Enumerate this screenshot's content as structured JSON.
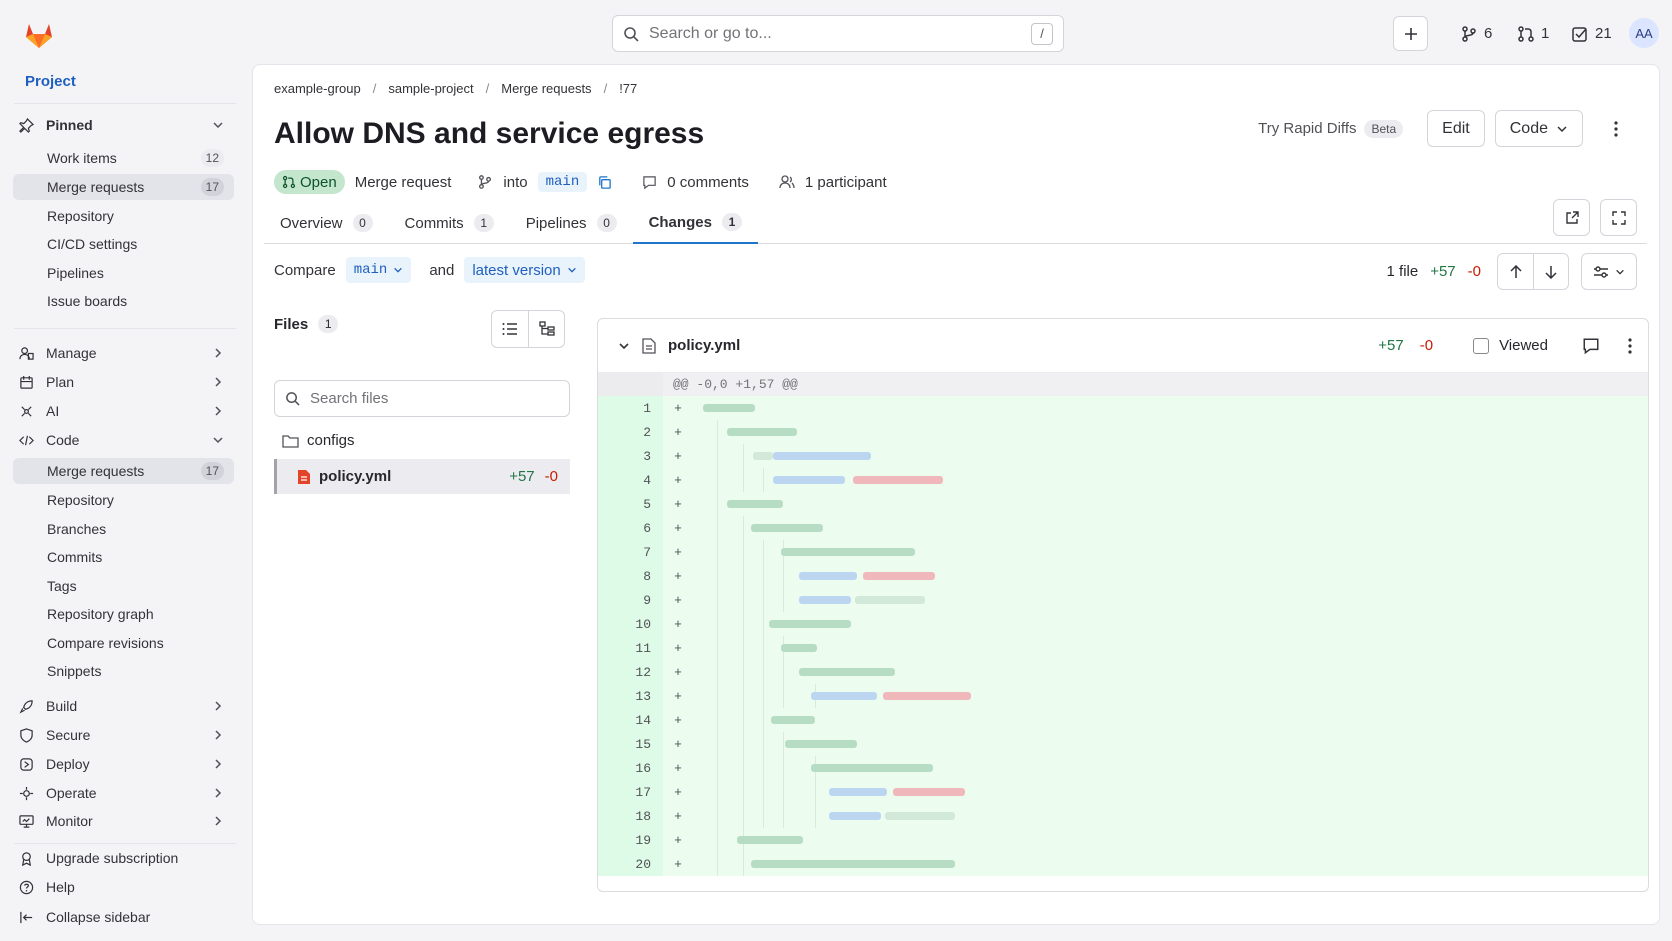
{
  "topbar": {
    "search_placeholder": "Search or go to...",
    "search_shortcut": "/",
    "assigned_mrs": "6",
    "review_mrs": "1",
    "todos": "21",
    "avatar_initials": "AA"
  },
  "sidebar": {
    "project_label": "Project",
    "pinned_label": "Pinned",
    "pinned": [
      {
        "label": "Work items",
        "count": "12"
      },
      {
        "label": "Merge requests",
        "count": "17"
      },
      {
        "label": "Repository"
      },
      {
        "label": "CI/CD settings"
      },
      {
        "label": "Pipelines"
      },
      {
        "label": "Issue boards"
      }
    ],
    "sections": {
      "manage": "Manage",
      "plan": "Plan",
      "ai": "AI",
      "code": "Code",
      "build": "Build",
      "secure": "Secure",
      "deploy": "Deploy",
      "operate": "Operate",
      "monitor": "Monitor"
    },
    "code_items": [
      {
        "label": "Merge requests",
        "count": "17"
      },
      {
        "label": "Repository"
      },
      {
        "label": "Branches"
      },
      {
        "label": "Commits"
      },
      {
        "label": "Tags"
      },
      {
        "label": "Repository graph"
      },
      {
        "label": "Compare revisions"
      },
      {
        "label": "Snippets"
      }
    ],
    "footer": {
      "upgrade": "Upgrade subscription",
      "help": "Help",
      "collapse": "Collapse sidebar"
    }
  },
  "breadcrumb": [
    "example-group",
    "sample-project",
    "Merge requests",
    "!77"
  ],
  "mr": {
    "title": "Allow DNS and service egress",
    "status": "Open",
    "type_label": "Merge request",
    "into_label": "into",
    "target_branch": "main",
    "comments": "0 comments",
    "participants": "1 participant"
  },
  "header_actions": {
    "rapid_diffs": "Try Rapid Diffs",
    "beta": "Beta",
    "edit": "Edit",
    "code": "Code"
  },
  "tabs": [
    {
      "label": "Overview",
      "count": "0"
    },
    {
      "label": "Commits",
      "count": "1"
    },
    {
      "label": "Pipelines",
      "count": "0"
    },
    {
      "label": "Changes",
      "count": "1"
    }
  ],
  "compare": {
    "label": "Compare",
    "base": "main",
    "and_label": "and",
    "head": "latest version"
  },
  "diffstats": {
    "files": "1 file",
    "added": "+57",
    "removed": "-0"
  },
  "file_browser": {
    "title": "Files",
    "count": "1",
    "search_placeholder": "Search files",
    "folder": "configs",
    "file": "policy.yml",
    "added": "+57",
    "removed": "-0"
  },
  "diff": {
    "filename": "policy.yml",
    "added": "+57",
    "removed": "-0",
    "viewed_label": "Viewed",
    "hunk": "@@ -0,0 +1,57 @@",
    "line_numbers": [
      "1",
      "2",
      "3",
      "4",
      "5",
      "6",
      "7",
      "8",
      "9",
      "10",
      "11",
      "12",
      "13",
      "14",
      "15",
      "16",
      "17",
      "18",
      "19",
      "20"
    ],
    "marker": "+"
  },
  "colors": {
    "accent": "#1f75cb",
    "added": "#217645",
    "removed": "#c91c00",
    "open_badge": "#c3e6cd"
  }
}
